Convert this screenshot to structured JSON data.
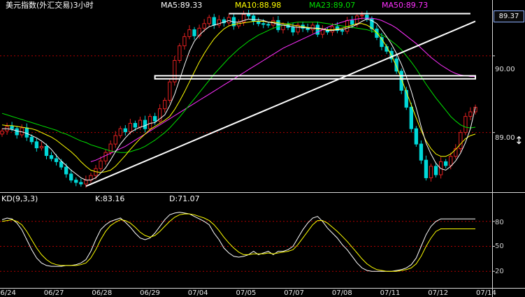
{
  "header": {
    "title": "美元指数(外汇交易)3小时",
    "ma5": "MA5:89.33",
    "ma10": "MA10:88.98",
    "ma23": "MA23:89.07",
    "ma50": "MA50:89.73"
  },
  "kd_header": {
    "name": "KD(9,3,3)",
    "k": "K:83.16",
    "d": "D:71.07"
  },
  "price_axis": {
    "current": "89.37",
    "labels": [
      "90.00",
      "89.00"
    ]
  },
  "kd_axis": {
    "labels": [
      "80",
      "50",
      "20"
    ]
  },
  "x_axis": {
    "labels": [
      "06/24",
      "06/27",
      "06/28",
      "06/29",
      "07/04",
      "07/05",
      "07/07",
      "07/08",
      "07/11",
      "07/12",
      "07/14"
    ]
  },
  "colors": {
    "up": "#e02020",
    "down": "#00d8d8",
    "ma5": "#ffffff",
    "ma10": "#ffff00",
    "ma23": "#00e000",
    "ma50": "#ff30ff",
    "title": "#ffffff",
    "k_line": "#ffffff",
    "d_line": "#ffff00",
    "grid": "#b00000"
  },
  "chart_data": [
    {
      "type": "candlestick",
      "title": "美元指数(外汇交易)3小时",
      "x": [
        "06/24",
        "06/27",
        "06/28",
        "06/29",
        "07/04",
        "07/05",
        "07/07",
        "07/08",
        "07/11",
        "07/12",
        "07/14"
      ],
      "ylim": [
        88.25,
        90.6
      ],
      "yticks": [
        89.0,
        90.0
      ],
      "current_price": 89.37,
      "grid": true,
      "close": [
        89.02,
        89.08,
        89.05,
        88.97,
        89.06,
        88.94,
        88.88,
        88.8,
        88.82,
        88.7,
        88.66,
        88.62,
        88.55,
        88.46,
        88.38,
        88.35,
        88.33,
        88.38,
        88.44,
        88.53,
        88.63,
        88.74,
        88.85,
        88.96,
        89.05,
        89.01,
        89.12,
        89.07,
        89.16,
        89.05,
        89.21,
        89.15,
        89.31,
        89.42,
        89.66,
        89.94,
        90.13,
        90.25,
        90.34,
        90.26,
        90.36,
        90.42,
        90.5,
        90.4,
        90.47,
        90.43,
        90.5,
        90.39,
        90.44,
        90.54,
        90.52,
        90.45,
        90.42,
        90.41,
        90.4,
        90.46,
        90.34,
        90.4,
        90.37,
        90.31,
        90.4,
        90.36,
        90.34,
        90.4,
        90.28,
        90.34,
        90.31,
        90.38,
        90.33,
        90.32,
        90.46,
        90.41,
        90.52,
        90.53,
        90.48,
        90.35,
        90.24,
        90.12,
        90.06,
        89.96,
        89.8,
        89.55,
        89.33,
        89.05,
        88.85,
        88.64,
        88.41,
        88.56,
        88.45,
        88.62,
        88.57,
        88.69,
        88.79,
        89.0,
        89.21,
        89.27,
        89.33
      ],
      "ma5": [
        89.05,
        89.05,
        89.04,
        89.02,
        89.01,
        88.99,
        88.96,
        88.93,
        88.89,
        88.84,
        88.78,
        88.7,
        88.63,
        88.57,
        88.51,
        88.46,
        88.41,
        88.38,
        88.38,
        88.41,
        88.47,
        88.54,
        88.64,
        88.75,
        88.85,
        88.93,
        89.0,
        89.04,
        89.07,
        89.09,
        89.12,
        89.13,
        89.18,
        89.23,
        89.35,
        89.5,
        89.69,
        89.88,
        90.06,
        90.19,
        90.27,
        90.33,
        90.38,
        90.4,
        90.42,
        90.44,
        90.46,
        90.44,
        90.44,
        90.46,
        90.48,
        90.47,
        90.47,
        90.46,
        90.44,
        90.43,
        90.41,
        90.4,
        90.39,
        90.38,
        90.37,
        90.37,
        90.36,
        90.36,
        90.36,
        90.35,
        90.33,
        90.33,
        90.34,
        90.34,
        90.36,
        90.38,
        90.41,
        90.45,
        90.48,
        90.46,
        90.42,
        90.34,
        90.25,
        90.15,
        90.03,
        89.89,
        89.73,
        89.54,
        89.32,
        89.08,
        88.86,
        88.72,
        88.6,
        88.53,
        88.51,
        88.56,
        88.63,
        88.73,
        88.87,
        89.05,
        89.33
      ],
      "ma10": [
        89.1,
        89.09,
        89.09,
        89.08,
        89.07,
        89.06,
        89.05,
        89.03,
        89.0,
        88.97,
        88.94,
        88.9,
        88.85,
        88.8,
        88.75,
        88.69,
        88.62,
        88.56,
        88.51,
        88.49,
        88.48,
        88.49,
        88.51,
        88.56,
        88.63,
        88.7,
        88.78,
        88.85,
        88.92,
        88.98,
        89.04,
        89.08,
        89.12,
        89.16,
        89.21,
        89.3,
        89.41,
        89.53,
        89.66,
        89.79,
        89.92,
        90.03,
        90.13,
        90.22,
        90.29,
        90.35,
        90.39,
        90.41,
        90.42,
        90.43,
        90.44,
        90.45,
        90.45,
        90.45,
        90.44,
        90.44,
        90.43,
        90.42,
        90.41,
        90.4,
        90.39,
        90.38,
        90.37,
        90.36,
        90.35,
        90.35,
        90.34,
        90.34,
        90.35,
        90.36,
        90.38,
        90.4,
        90.42,
        90.42,
        90.4,
        90.36,
        90.3,
        90.22,
        90.12,
        90.0,
        89.86,
        89.7,
        89.53,
        89.36,
        89.19,
        89.03,
        88.89,
        88.79,
        88.72,
        88.69,
        88.69,
        88.72,
        88.78,
        88.85,
        88.92,
        88.96,
        88.98
      ],
      "ma23": [
        89.25,
        89.23,
        89.21,
        89.19,
        89.17,
        89.15,
        89.13,
        89.11,
        89.09,
        89.07,
        89.05,
        89.03,
        89.0,
        88.98,
        88.95,
        88.92,
        88.89,
        88.87,
        88.84,
        88.82,
        88.8,
        88.78,
        88.76,
        88.75,
        88.74,
        88.74,
        88.75,
        88.77,
        88.79,
        88.82,
        88.86,
        88.9,
        88.95,
        89.0,
        89.06,
        89.13,
        89.2,
        89.28,
        89.36,
        89.44,
        89.52,
        89.6,
        89.68,
        89.76,
        89.83,
        89.9,
        89.97,
        90.03,
        90.09,
        90.14,
        90.19,
        90.23,
        90.27,
        90.3,
        90.33,
        90.36,
        90.38,
        90.4,
        90.42,
        90.43,
        90.44,
        90.44,
        90.44,
        90.44,
        90.44,
        90.43,
        90.42,
        90.41,
        90.4,
        90.39,
        90.38,
        90.37,
        90.36,
        90.35,
        90.34,
        90.32,
        90.3,
        90.27,
        90.24,
        90.19,
        90.14,
        90.08,
        90.0,
        89.92,
        89.83,
        89.73,
        89.63,
        89.54,
        89.45,
        89.37,
        89.29,
        89.21,
        89.15,
        89.1,
        89.07,
        89.06,
        89.07
      ],
      "ma50": [
        null,
        null,
        null,
        null,
        null,
        null,
        null,
        null,
        null,
        null,
        null,
        null,
        null,
        null,
        null,
        null,
        null,
        null,
        88.62,
        88.64,
        88.67,
        88.7,
        88.73,
        88.76,
        88.79,
        88.82,
        88.86,
        88.9,
        88.94,
        88.98,
        89.02,
        89.06,
        89.1,
        89.14,
        89.18,
        89.22,
        89.26,
        89.3,
        89.34,
        89.38,
        89.42,
        89.46,
        89.5,
        89.54,
        89.58,
        89.62,
        89.66,
        89.7,
        89.74,
        89.78,
        89.82,
        89.86,
        89.9,
        89.94,
        89.98,
        90.02,
        90.06,
        90.1,
        90.13,
        90.16,
        90.19,
        90.22,
        90.25,
        90.28,
        90.31,
        90.34,
        90.37,
        90.4,
        90.42,
        90.44,
        90.46,
        90.47,
        90.48,
        90.49,
        90.49,
        90.49,
        90.48,
        90.46,
        90.43,
        90.4,
        90.36,
        90.31,
        90.26,
        90.21,
        90.16,
        90.1,
        90.04,
        89.98,
        89.93,
        89.88,
        89.84,
        89.8,
        89.77,
        89.75,
        89.74,
        89.73,
        89.73
      ],
      "annotations": [
        {
          "type": "trendline",
          "from": [
            17,
            88.3
          ],
          "to": [
            96,
            90.45
          ]
        },
        {
          "type": "horizontal_band",
          "from_index": 31,
          "to_index": 96,
          "ylim": [
            89.7,
            89.74
          ]
        },
        {
          "type": "horizontal_line",
          "from_index": 46,
          "to_index": 95,
          "y": 90.55
        }
      ]
    },
    {
      "type": "line",
      "title": "KD(9,3,3)",
      "ylim": [
        0,
        100
      ],
      "yticks": [
        20,
        50,
        80
      ],
      "series": [
        {
          "name": "K",
          "values": [
            82,
            84,
            83,
            78,
            70,
            58,
            46,
            36,
            30,
            27,
            26,
            26,
            26,
            27,
            27,
            28,
            30,
            34,
            44,
            58,
            70,
            76,
            80,
            82,
            84,
            79,
            73,
            66,
            60,
            58,
            60,
            66,
            74,
            82,
            88,
            90,
            91,
            90,
            89,
            86,
            83,
            80,
            76,
            66,
            58,
            48,
            42,
            38,
            37,
            38,
            40,
            44,
            40,
            42,
            44,
            40,
            44,
            44,
            46,
            50,
            60,
            70,
            78,
            84,
            86,
            80,
            72,
            66,
            60,
            52,
            46,
            38,
            30,
            24,
            21,
            20,
            20,
            20,
            20,
            20,
            21,
            22,
            24,
            28,
            36,
            50,
            64,
            74,
            80,
            83,
            83,
            83,
            83,
            83,
            83,
            83,
            83
          ]
        },
        {
          "name": "D",
          "values": [
            80,
            81,
            82,
            80,
            76,
            68,
            58,
            48,
            40,
            34,
            30,
            28,
            27,
            27,
            27,
            27,
            28,
            30,
            36,
            46,
            58,
            68,
            75,
            79,
            82,
            81,
            78,
            73,
            67,
            63,
            61,
            63,
            68,
            74,
            80,
            85,
            88,
            89,
            89,
            88,
            86,
            84,
            81,
            76,
            69,
            61,
            54,
            48,
            43,
            40,
            40,
            41,
            41,
            41,
            42,
            41,
            42,
            43,
            44,
            46,
            52,
            60,
            68,
            76,
            81,
            81,
            78,
            73,
            68,
            62,
            56,
            49,
            42,
            35,
            29,
            25,
            22,
            21,
            20,
            20,
            20,
            21,
            22,
            24,
            29,
            38,
            50,
            60,
            68,
            71,
            71,
            71,
            71,
            71,
            71,
            71,
            71
          ]
        }
      ]
    }
  ]
}
